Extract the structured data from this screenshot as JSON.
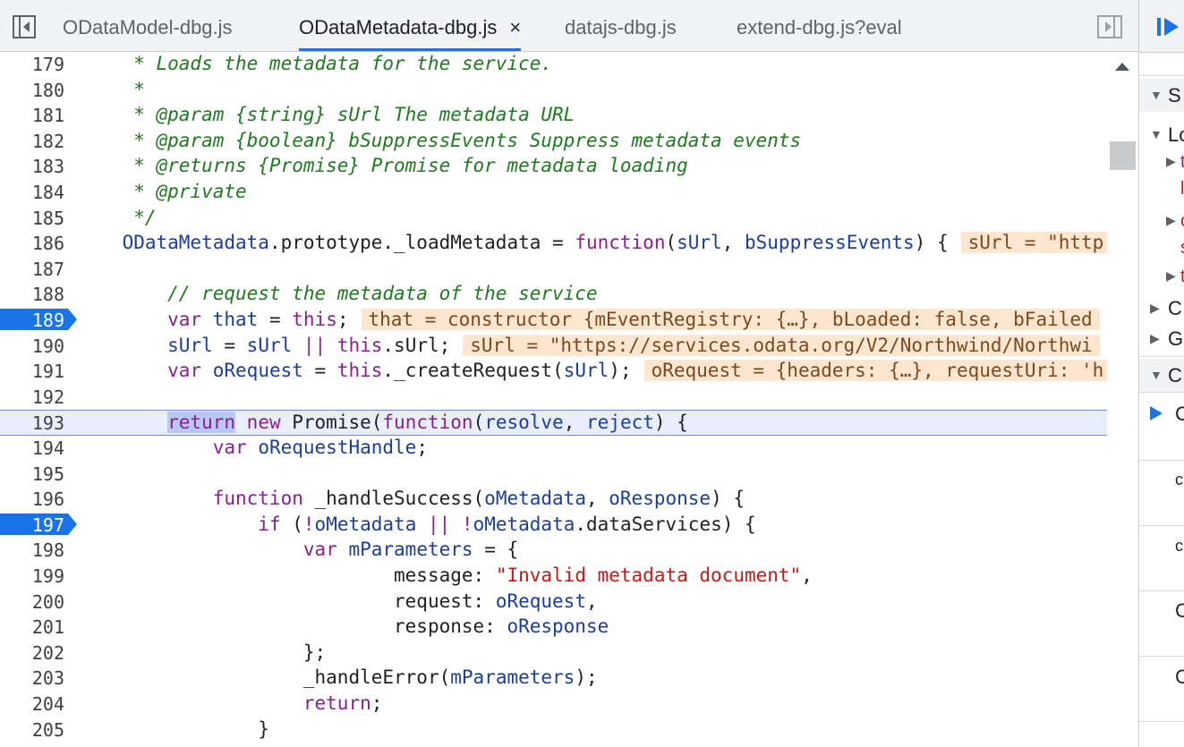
{
  "tabs": [
    {
      "label": "ODataModel-dbg.js",
      "active": false
    },
    {
      "label": "ODataMetadata-dbg.js",
      "active": true,
      "close": "×"
    },
    {
      "label": "datajs-dbg.js",
      "active": false
    },
    {
      "label": "extend-dbg.js?eval",
      "active": false
    }
  ],
  "sidebar": {
    "rows": [
      "S",
      "Lo",
      "C",
      "Gl",
      "C",
      "c",
      "c",
      "C",
      "C"
    ]
  },
  "colors": {
    "breakpoint": "#1a73e8",
    "inline_value_bg": "#fde6cf",
    "current_line_bg": "#e8eefe"
  },
  "editor": {
    "lines": [
      {
        "num": "179"
      },
      {
        "num": "180"
      },
      {
        "num": "181"
      },
      {
        "num": "182"
      },
      {
        "num": "183"
      },
      {
        "num": "184"
      },
      {
        "num": "185"
      },
      {
        "num": "186",
        "inline": "sUrl = \"http"
      },
      {
        "num": "187"
      },
      {
        "num": "188"
      },
      {
        "num": "189",
        "breakpoint": true,
        "inline": "that = constructor {mEventRegistry: {…}, bLoaded: false, bFailed"
      },
      {
        "num": "190",
        "inline": "sUrl = \"https://services.odata.org/V2/Northwind/Northwi"
      },
      {
        "num": "191",
        "inline": "oRequest = {headers: {…}, requestUri: 'h"
      },
      {
        "num": "192"
      },
      {
        "num": "193",
        "current": true
      },
      {
        "num": "194"
      },
      {
        "num": "195"
      },
      {
        "num": "196"
      },
      {
        "num": "197",
        "breakpoint": true
      },
      {
        "num": "198"
      },
      {
        "num": "199"
      },
      {
        "num": "200"
      },
      {
        "num": "201"
      },
      {
        "num": "202"
      },
      {
        "num": "203"
      },
      {
        "num": "204"
      },
      {
        "num": "205"
      }
    ],
    "text": {
      "l179": "     * Loads the metadata for the service.",
      "l180": "     *",
      "l181": "     * @param {string} sUrl The metadata URL",
      "l182": "     * @param {boolean} bSuppressEvents Suppress metadata events",
      "l183": "     * @returns {Promise} Promise for metadata loading",
      "l184": "     * @private",
      "l185": "     */",
      "l186a": "    ODataMetadata",
      "l186b": ".prototype._loadMetadata = ",
      "l186c": "function",
      "l186d": "(",
      "l186e": "sUrl",
      "l186f": ", ",
      "l186g": "bSuppressEvents",
      "l186h": ") {",
      "l188": "        // request the metadata of the service",
      "l189a": "var",
      "l189b": "that",
      "l189c": " = ",
      "l189d": "this",
      "l189e": ";",
      "l190a": "sUrl",
      "l190b": " = ",
      "l190c": "sUrl",
      "l190d": " || ",
      "l190e": "this",
      "l190f": ".sUrl;",
      "l191a": "var",
      "l191b": "oRequest",
      "l191c": " = ",
      "l191d": "this",
      "l191e": "._createRequest(",
      "l191f": "sUrl",
      "l191g": ");",
      "l193a": "return",
      "l193b": "new",
      "l193c": " Promise(",
      "l193d": "function",
      "l193e": "(",
      "l193f": "resolve",
      "l193g": ", ",
      "l193h": "reject",
      "l193i": ") {",
      "l194a": "var",
      "l194b": "oRequestHandle",
      "l194c": ";",
      "l196a": "function",
      "l196b": " _handleSuccess(",
      "l196c": "oMetadata",
      "l196d": ", ",
      "l196e": "oResponse",
      "l196f": ") {",
      "l197a": "if",
      "l197b": " (",
      "l197c": "!",
      "l197d": "oMetadata",
      "l197e": " || ",
      "l197f": "!",
      "l197g": "oMetadata",
      "l197h": ".dataServices) {",
      "l198a": "var",
      "l198b": "mParameters",
      "l198c": " = {",
      "l199a": "message: ",
      "l199b": "\"Invalid metadata document\"",
      "l199c": ",",
      "l200a": "request: ",
      "l200b": "oRequest",
      "l200c": ",",
      "l201a": "response: ",
      "l201b": "oResponse",
      "l202": "};",
      "l203a": "_handleError(",
      "l203b": "mParameters",
      "l203c": ");",
      "l204a": "return",
      "l204b": ";",
      "l205": "}"
    }
  }
}
